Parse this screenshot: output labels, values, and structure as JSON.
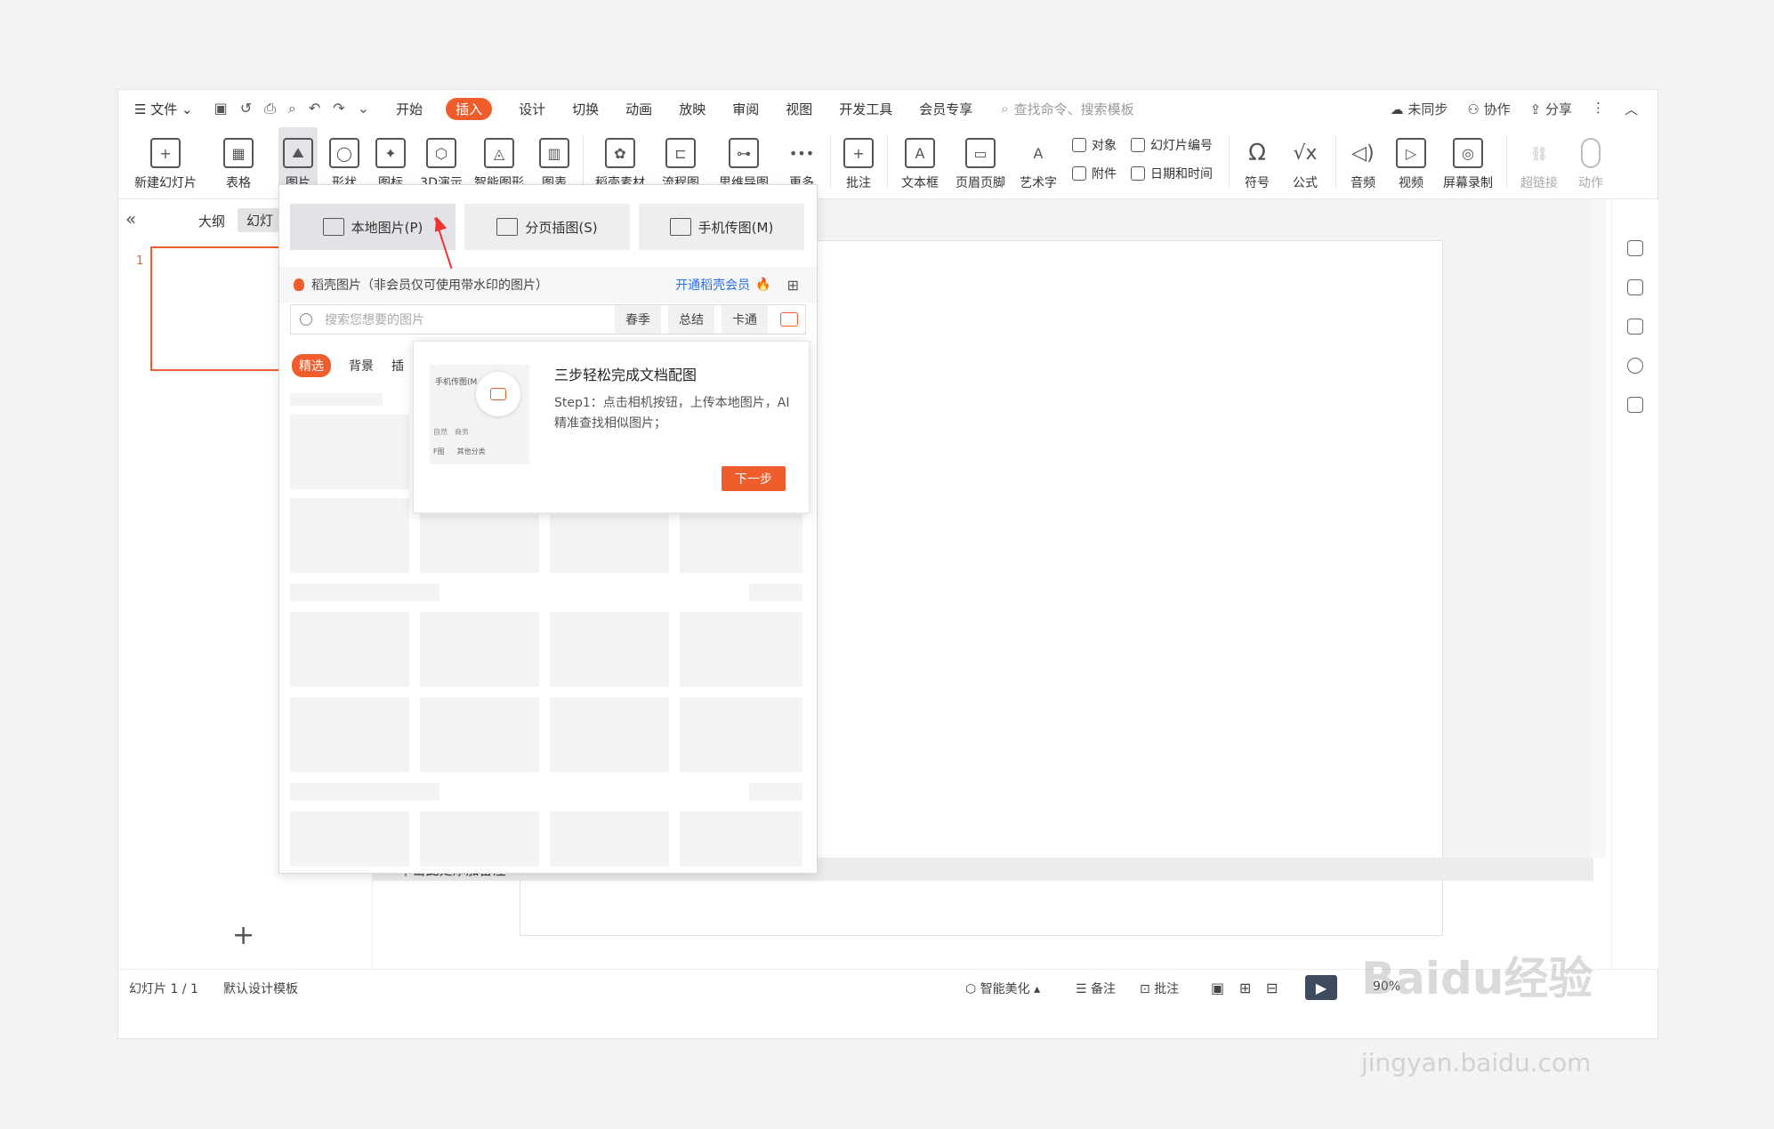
{
  "menu": {
    "file": "文件",
    "tabs": [
      "开始",
      "插入",
      "设计",
      "切换",
      "动画",
      "放映",
      "审阅",
      "视图",
      "开发工具",
      "会员专享"
    ],
    "search_placeholder": "查找命令、搜索模板",
    "right": [
      "未同步",
      "协作",
      "分享"
    ]
  },
  "ribbon": {
    "new_slide": "新建幻灯片",
    "table": "表格",
    "picture": "图片",
    "shape": "形状",
    "icon": "图标",
    "3d": "3D演示",
    "smart": "智能图形",
    "chart": "图表",
    "material": "稻壳素材",
    "flow": "流程图",
    "mind": "思维导图",
    "more": "更多",
    "comment": "批注",
    "textbox": "文本框",
    "header": "页眉页脚",
    "art": "艺术字",
    "object": "对象",
    "attach": "附件",
    "slide_no": "幻灯片编号",
    "datetime": "日期和时间",
    "symbol": "符号",
    "formula": "公式",
    "audio": "音频",
    "video": "视频",
    "record": "屏幕录制",
    "link": "超链接",
    "action": "动作"
  },
  "left": {
    "outline": "大纲",
    "slides": "幻灯",
    "slide_number": "1"
  },
  "panel": {
    "local": "本地图片(P)",
    "paged": "分页插图(S)",
    "phone": "手机传图(M)",
    "notice": "稻壳图片（非会员仅可使用带水印的图片）",
    "vip": "开通稻壳会员",
    "search_placeholder": "搜索您想要的图片",
    "tags": [
      "春季",
      "总结",
      "卡通"
    ],
    "cats": [
      "精选",
      "背景",
      "插"
    ]
  },
  "tooltip": {
    "title": "三步轻松完成文档配图",
    "body": "Step1：点击相机按钮，上传本地图片，AI精准查找相似图片；",
    "next": "下一步",
    "thumb_label": "手机传图(M",
    "thumb_tags": [
      "自然",
      "商务"
    ],
    "thumb_more": [
      "F图",
      "其他分类"
    ]
  },
  "notes": "单击此处添加备注",
  "status": {
    "slide_info": "幻灯片 1 / 1",
    "template": "默认设计模板",
    "beautify": "智能美化",
    "notes": "备注",
    "comment": "批注",
    "zoom": "90%"
  },
  "watermark": {
    "brand": "Baidu经验",
    "url": "jingyan.baidu.com"
  }
}
